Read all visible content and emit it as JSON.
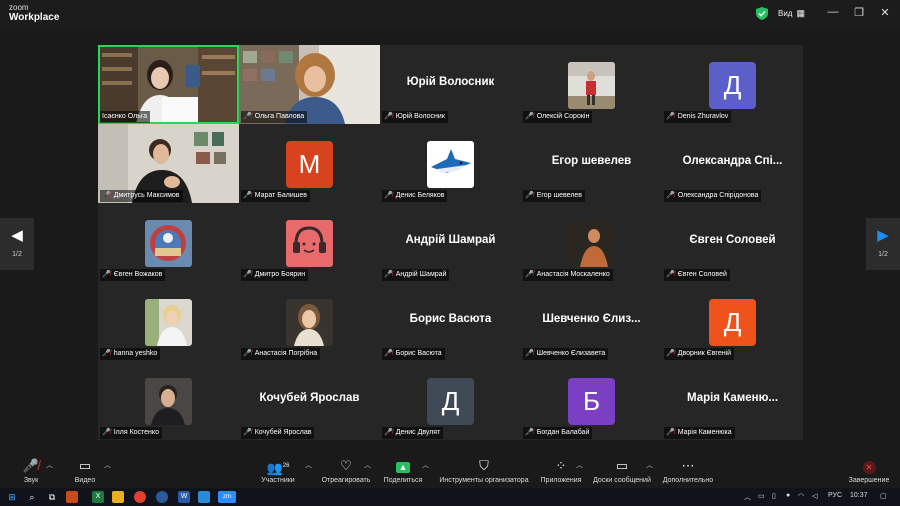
{
  "window": {
    "app_name_line1": "zoom",
    "app_name_line2": "Workplace",
    "view_label": "Вид",
    "minimize": "—",
    "restore": "❐",
    "close": "✕"
  },
  "pager": {
    "left_page": "1/2",
    "right_page": "1/2"
  },
  "tiles": [
    {
      "label": "Ісаєнко Ольга",
      "kind": "video"
    },
    {
      "label": "Ольга Павлова",
      "kind": "video"
    },
    {
      "label": "Юрій Волосник",
      "kind": "name",
      "big": "Юрій Волосник"
    },
    {
      "label": "Олексій Сорокін",
      "kind": "photo"
    },
    {
      "label": "Denis Zhuravlov",
      "kind": "avatar",
      "letter": "Д",
      "color": "#5b5fc7"
    },
    {
      "label": "Дмитрусь Максимов",
      "kind": "video"
    },
    {
      "label": "Марат Балишев",
      "kind": "avatar",
      "letter": "M",
      "color": "#d9421f"
    },
    {
      "label": "Денис Беляков",
      "kind": "photo"
    },
    {
      "label": "Егор шевелев",
      "kind": "name",
      "big": "Егор шевелев"
    },
    {
      "label": "Олександра Спірідонова",
      "kind": "name",
      "big": "Олександра Спі..."
    },
    {
      "label": "Євген Вожаков",
      "kind": "photo"
    },
    {
      "label": "Дмитро Боярин",
      "kind": "photo"
    },
    {
      "label": "Андрій Шамрай",
      "kind": "name",
      "big": "Андрій Шамрай"
    },
    {
      "label": "Анастасія Москаленко",
      "kind": "photo"
    },
    {
      "label": "Євген Соловей",
      "kind": "name",
      "big": "Євген Соловей"
    },
    {
      "label": "hanna yeshko",
      "kind": "photo"
    },
    {
      "label": "Анастасія Погрібна",
      "kind": "photo"
    },
    {
      "label": "Борис Васюта",
      "kind": "name",
      "big": "Борис Васюта"
    },
    {
      "label": "Шевченко Єлизавета",
      "kind": "name",
      "big": "Шевченко Єлиз..."
    },
    {
      "label": "Дворник Євгеній",
      "kind": "avatar",
      "letter": "Д",
      "color": "#f0521c"
    },
    {
      "label": "Ілля Костенко",
      "kind": "photo"
    },
    {
      "label": "Кочубей Ярослав",
      "kind": "name",
      "big": "Кочубей Ярослав"
    },
    {
      "label": "Денис Двулят",
      "kind": "avatar",
      "letter": "Д",
      "color": "#3f4a56"
    },
    {
      "label": "Богдан Балабай",
      "kind": "avatar",
      "letter": "Б",
      "color": "#7b3fc4"
    },
    {
      "label": "Марія Каменюка",
      "kind": "name",
      "big": "Марія Каменю..."
    }
  ],
  "toolbar": {
    "audio": "Звук",
    "video": "Видео",
    "participants": "Участники",
    "participants_count": "26",
    "react": "Отреагировать",
    "share": "Поделиться",
    "host_tools": "Инструменты организатора",
    "apps": "Приложения",
    "whiteboards": "Доски сообщений",
    "more": "Дополнительно",
    "end": "Завершение"
  },
  "taskbar": {
    "lang": "РУС",
    "time": "10:37"
  },
  "colors": {
    "active_speaker": "#23d959",
    "mute_red": "#e33333",
    "share_green": "#23c160",
    "accent_blue": "#0e72ed"
  }
}
